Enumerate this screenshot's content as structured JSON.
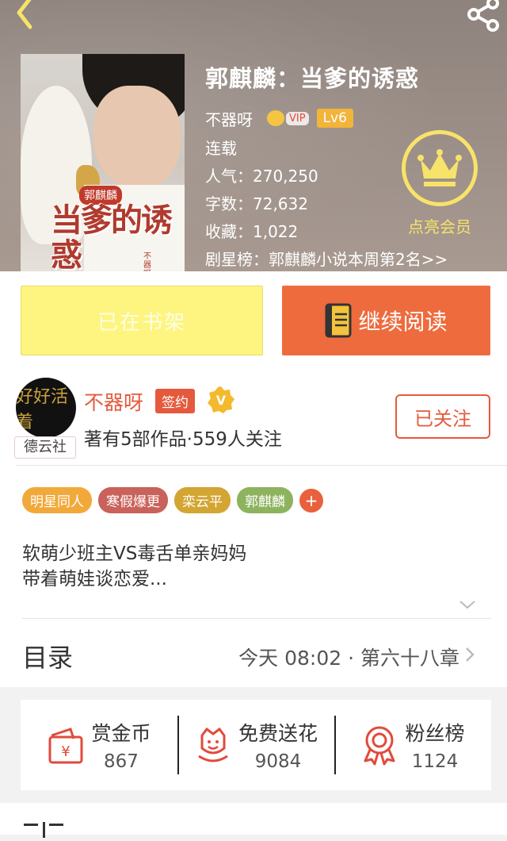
{
  "header": {
    "book_title": "郭麒麟：当爹的诱惑",
    "author": "不器呀",
    "vip_label": "VIP",
    "level": "Lv6",
    "status": "连载",
    "popularity": "人气：270,250",
    "word_count": "字数：72,632",
    "favorites": "收藏：1,022",
    "ranking": "剧星榜：郭麒麟小说本周第2名>>",
    "member_label": "点亮会员",
    "cover": {
      "badge": "郭麒麟",
      "title": "当爹的诱惑",
      "subtitle": "不器呀"
    }
  },
  "actions": {
    "shelf_label": "已在书架",
    "read_label": "继续阅读"
  },
  "author_section": {
    "avatar_text": "好好活着",
    "avatar_tag": "德云社",
    "name": "不器呀",
    "sign_label": "签约",
    "meta": "著有5部作品·559人关注",
    "follow_label": "已关注"
  },
  "tags": [
    {
      "label": "明星同人",
      "color": "#f2a93b"
    },
    {
      "label": "寒假爆更",
      "color": "#c9625a"
    },
    {
      "label": "栾云平",
      "color": "#d3a532"
    },
    {
      "label": "郭麒麟",
      "color": "#8db35e"
    }
  ],
  "tag_add": "+",
  "description": {
    "line1": "软萌少班主VS毒舌单亲妈妈",
    "line2": "带着萌娃谈恋爱..."
  },
  "catalog": {
    "label": "目录",
    "latest": "今天 08:02 · 第六十八章"
  },
  "stats": [
    {
      "label": "赏金币",
      "value": "867",
      "icon": "coin-icon"
    },
    {
      "label": "免费送花",
      "value": "9084",
      "icon": "flower-icon"
    },
    {
      "label": "粉丝榜",
      "value": "1124",
      "icon": "medal-icon"
    }
  ],
  "colors": {
    "accent": "#ee6b3d",
    "shelf_yellow": "#fdf57f",
    "member_gold": "#f7e36a"
  }
}
